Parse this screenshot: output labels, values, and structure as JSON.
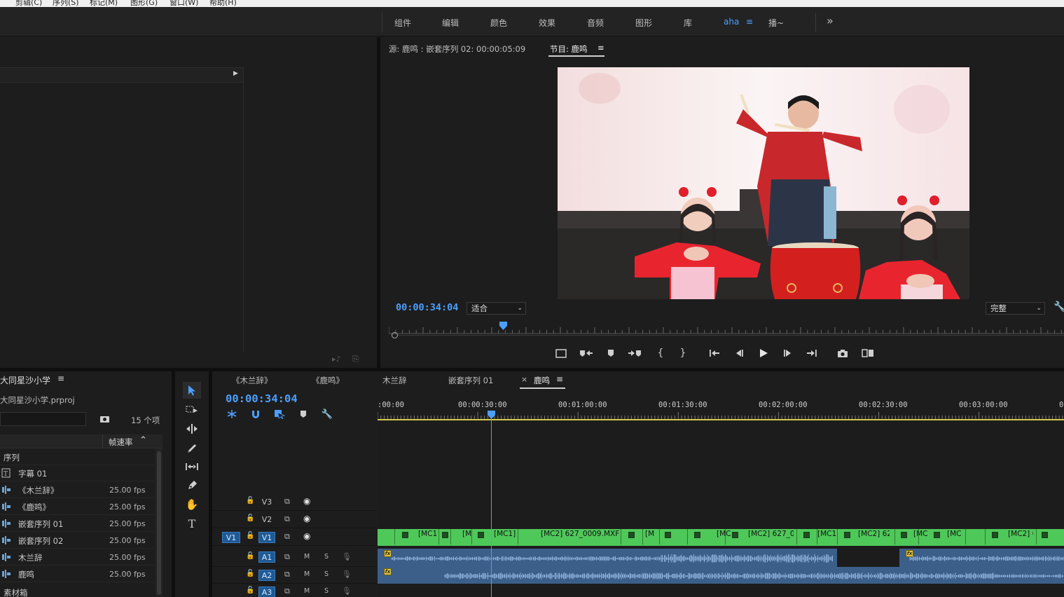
{
  "menubar": {
    "items": [
      "剪辑(C)",
      "序列(S)",
      "标记(M)",
      "图形(G)",
      "窗口(W)",
      "帮助(H)"
    ]
  },
  "workspaces": {
    "tabs": [
      "组件",
      "编辑",
      "颜色",
      "效果",
      "音频",
      "图形",
      "库",
      "aha",
      "播~"
    ],
    "active": "aha",
    "more": "»"
  },
  "source_monitor": {
    "source_tab": "源: 鹿鸣 : 嵌套序列 02: 00:00:05:09",
    "program_tab": "节目: 鹿鸣",
    "menu_icon": "≡"
  },
  "program_monitor": {
    "timecode": "00:00:34:04",
    "zoom": "适合",
    "quality": "完整",
    "playhead_fraction": 0.17
  },
  "project": {
    "title": "大同星沙小学",
    "menu_icon": "≡",
    "file": "大同星沙小学.prproj",
    "item_count": "15 个项",
    "header": "帧速率",
    "folder_seq": "序列",
    "rows": [
      {
        "name": "字幕 01",
        "fps": "",
        "icon": "title-icon"
      },
      {
        "name": "《木兰辞》",
        "fps": "25.00 fps",
        "icon": "sequence-icon"
      },
      {
        "name": "《鹿鸣》",
        "fps": "25.00 fps",
        "icon": "sequence-icon"
      },
      {
        "name": "嵌套序列 01",
        "fps": "25.00 fps",
        "icon": "sequence-icon"
      },
      {
        "name": "嵌套序列 02",
        "fps": "25.00 fps",
        "icon": "sequence-icon"
      },
      {
        "name": "木兰辞",
        "fps": "25.00 fps",
        "icon": "sequence-icon"
      },
      {
        "name": "鹿鸣",
        "fps": "25.00 fps",
        "icon": "sequence-icon"
      }
    ],
    "bin": "素材箱"
  },
  "timeline": {
    "tabs": [
      "《木兰辞》",
      "《鹿鸣》",
      "木兰辞",
      "嵌套序列 01",
      "鹿鸣"
    ],
    "active_tab": "鹿鸣",
    "close": "×",
    "menu_icon": "≡",
    "timecode": "00:00:34:04",
    "ruler": [
      ":00:00",
      "00:00:30:00",
      "00:01:00:00",
      "00:01:30:00",
      "00:02:00:00",
      "00:02:30:00",
      "00:03:00:00",
      "0"
    ],
    "tracks": {
      "V3": "V3",
      "V2": "V2",
      "V1": "V1",
      "V1_src": "V1",
      "A1": "A1",
      "A2": "A2",
      "A3": "A3",
      "mute": "M",
      "solo": "S"
    },
    "clips": [
      "[MC1]",
      "[M",
      "[MC1]",
      "[MC2] 627_0009.MXF",
      "[M",
      "[MC",
      "[MC2] 627_0",
      "[MC1",
      "[MC2] 62",
      "[MC",
      "[MC",
      "[MC2] 6"
    ],
    "fx": "fx"
  },
  "colors": {
    "accent": "#4c9fff",
    "video_clip": "#4fc85a",
    "audio_clip": "#3c5f8a",
    "panel": "#1d1d1d"
  }
}
